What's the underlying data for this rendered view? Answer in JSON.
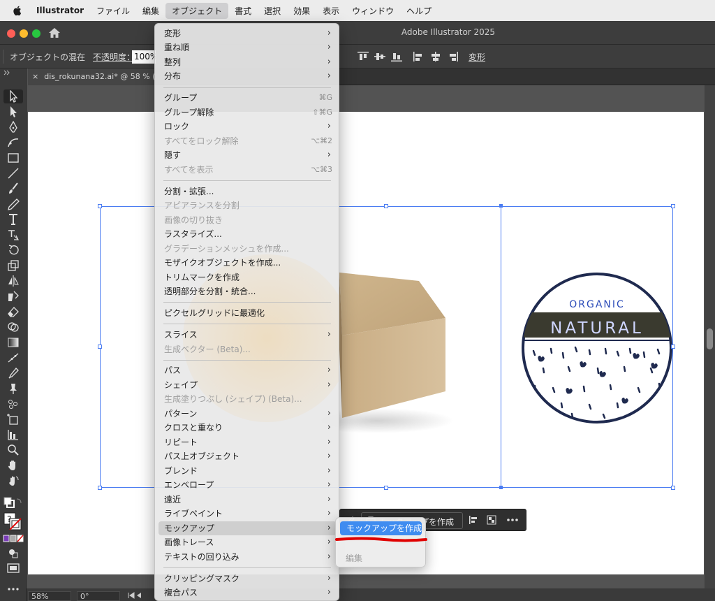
{
  "menubar": {
    "app_name": "Illustrator",
    "items": [
      "ファイル",
      "編集",
      "オブジェクト",
      "書式",
      "選択",
      "効果",
      "表示",
      "ウィンドウ",
      "ヘルプ"
    ],
    "active_item": "オブジェクト"
  },
  "window": {
    "title": "Adobe Illustrator 2025"
  },
  "control_bar": {
    "mode_label": "オブジェクトの混在",
    "opacity_label": "不透明度：",
    "opacity_value": "100%",
    "transform_label": "変形"
  },
  "document": {
    "tab_close": "×",
    "tab_title": "dis_rokunana32.ai* @ 58 % (RGB"
  },
  "artwork": {
    "badge_top_text": "ORGANIC",
    "badge_main_text": "NATURAL"
  },
  "context_bar": {
    "mockup_button_label": "モックアップを作成"
  },
  "status_bar": {
    "zoom": "58%",
    "rotation": "0°"
  },
  "object_menu": {
    "items": [
      {
        "label": "変形",
        "submenu": true
      },
      {
        "label": "重ね順",
        "submenu": true
      },
      {
        "label": "整列",
        "submenu": true
      },
      {
        "label": "分布",
        "submenu": true
      },
      {
        "label": "グループ",
        "shortcut": "⌘G"
      },
      {
        "label": "グループ解除",
        "shortcut": "⇧⌘G"
      },
      {
        "label": "ロック",
        "submenu": true
      },
      {
        "label": "すべてをロック解除",
        "shortcut": "⌥⌘2",
        "disabled": true
      },
      {
        "label": "隠す",
        "submenu": true
      },
      {
        "label": "すべてを表示",
        "shortcut": "⌥⌘3",
        "disabled": true
      },
      {
        "label": "分割・拡張..."
      },
      {
        "label": "アピアランスを分割",
        "disabled": true
      },
      {
        "label": "画像の切り抜き",
        "disabled": true
      },
      {
        "label": "ラスタライズ..."
      },
      {
        "label": "グラデーションメッシュを作成...",
        "disabled": true
      },
      {
        "label": "モザイクオブジェクトを作成..."
      },
      {
        "label": "トリムマークを作成"
      },
      {
        "label": "透明部分を分割・統合..."
      },
      {
        "label": "ピクセルグリッドに最適化"
      },
      {
        "label": "スライス",
        "submenu": true
      },
      {
        "label": "生成ベクター (Beta)...",
        "disabled": true
      },
      {
        "label": "パス",
        "submenu": true
      },
      {
        "label": "シェイプ",
        "submenu": true
      },
      {
        "label": "生成塗りつぶし (シェイプ) (Beta)...",
        "disabled": true
      },
      {
        "label": "パターン",
        "submenu": true
      },
      {
        "label": "クロスと重なり",
        "submenu": true
      },
      {
        "label": "リピート",
        "submenu": true
      },
      {
        "label": "パス上オブジェクト",
        "submenu": true
      },
      {
        "label": "ブレンド",
        "submenu": true
      },
      {
        "label": "エンベロープ",
        "submenu": true
      },
      {
        "label": "遠近",
        "submenu": true
      },
      {
        "label": "ライブペイント",
        "submenu": true
      },
      {
        "label": "モックアップ",
        "submenu": true,
        "highlighted": true
      },
      {
        "label": "画像トレース",
        "submenu": true
      },
      {
        "label": "テキストの回り込み",
        "submenu": true
      },
      {
        "label": "クリッピングマスク",
        "submenu": true
      },
      {
        "label": "複合パス",
        "submenu": true
      }
    ]
  },
  "mockup_submenu": {
    "create_label": "モックアップを作成",
    "edit_label": "編集"
  },
  "colors": {
    "selection": "#4a7cf2",
    "menu_highlight": "#3f8cf0",
    "badge_navy": "#1f2a4f",
    "badge_band": "#3a3a2f",
    "kraft": "#c9ad84"
  }
}
